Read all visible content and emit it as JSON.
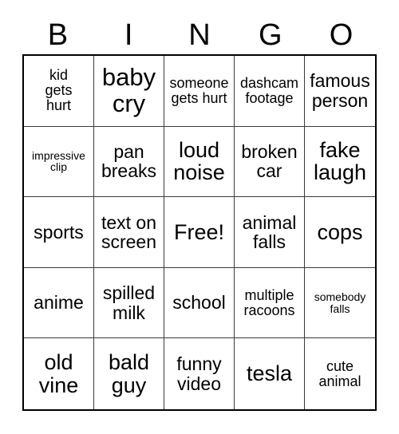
{
  "card": {
    "type": "bingo-card",
    "columns": 5,
    "rows": 5,
    "background_color": "#ffffff",
    "text_color": "#000000",
    "border_color": "#000000",
    "gridline_color": "#3a3a3a"
  },
  "header": {
    "letters": [
      "B",
      "I",
      "N",
      "G",
      "O"
    ]
  },
  "grid": {
    "cells": [
      {
        "text": "kid\ngets\nhurt",
        "size": "sm"
      },
      {
        "text": "baby\ncry",
        "size": "xl"
      },
      {
        "text": "someone\ngets hurt",
        "size": "sm"
      },
      {
        "text": "dashcam\nfootage",
        "size": "sm"
      },
      {
        "text": "famous\nperson",
        "size": "md"
      },
      {
        "text": "impressive\nclip",
        "size": "xs"
      },
      {
        "text": "pan\nbreaks",
        "size": "md"
      },
      {
        "text": "loud\nnoise",
        "size": "lg"
      },
      {
        "text": "broken\ncar",
        "size": "md"
      },
      {
        "text": "fake\nlaugh",
        "size": "lg"
      },
      {
        "text": "sports",
        "size": "md"
      },
      {
        "text": "text on\nscreen",
        "size": "md"
      },
      {
        "text": "Free!",
        "size": "lg"
      },
      {
        "text": "animal\nfalls",
        "size": "md"
      },
      {
        "text": "cops",
        "size": "lg"
      },
      {
        "text": "anime",
        "size": "md"
      },
      {
        "text": "spilled\nmilk",
        "size": "md"
      },
      {
        "text": "school",
        "size": "md"
      },
      {
        "text": "multiple\nracoons",
        "size": "sm"
      },
      {
        "text": "somebody\nfalls",
        "size": "xs"
      },
      {
        "text": "old\nvine",
        "size": "lg"
      },
      {
        "text": "bald\nguy",
        "size": "lg"
      },
      {
        "text": "funny\nvideo",
        "size": "md"
      },
      {
        "text": "tesla",
        "size": "lg"
      },
      {
        "text": "cute\nanimal",
        "size": "sm"
      }
    ]
  }
}
